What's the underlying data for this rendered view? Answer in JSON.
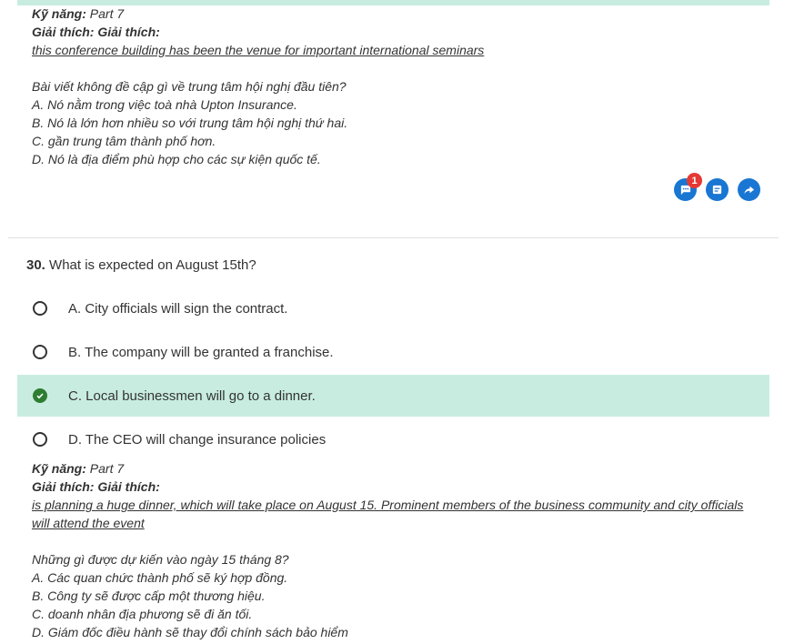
{
  "prev": {
    "skill_label": "Kỹ năng:",
    "skill_value": "Part 7",
    "explain_label": "Giải thích: Giải thích:",
    "quote": "this conference building has been the venue for important international seminars",
    "vi_question": "Bài viết không đề cập gì về trung tâm hội nghị đầu tiên?",
    "vi_options": [
      "A. Nó nằm trong việc toà nhà Upton Insurance.",
      "B. Nó là lớn hơn nhiều so với trung tâm hội nghị thứ hai.",
      "C. gần trung tâm thành phố hơn.",
      "D. Nó là địa điểm phù hợp cho các sự kiện quốc tế."
    ]
  },
  "actions": {
    "comment_icon": "comment-icon",
    "comment_badge": "1",
    "note_icon": "note-icon",
    "share_icon": "share-icon"
  },
  "question": {
    "number": "30.",
    "text": "What is expected on August 15th?",
    "options": [
      {
        "label": "A. City officials will sign the contract.",
        "state": "unselected"
      },
      {
        "label": "B. The company will be granted a franchise.",
        "state": "unselected"
      },
      {
        "label": "C. Local businessmen will go to a dinner.",
        "state": "correct"
      },
      {
        "label": "D. The CEO will change insurance policies",
        "state": "unselected"
      }
    ]
  },
  "explanation": {
    "skill_label": "Kỹ năng:",
    "skill_value": "Part 7",
    "explain_label": "Giải thích: Giải thích:",
    "quote": "is planning a huge dinner, which will take place on August 15. Prominent members of the business community and city officials will attend the event",
    "vi_question": "Những gì được dự kiến vào ngày 15 tháng 8?",
    "vi_options": [
      "A. Các quan chức thành phố sẽ ký hợp đồng.",
      "B. Công ty sẽ được cấp một thương hiệu.",
      "C. doanh nhân địa phương sẽ đi ăn tối.",
      "D. Giám đốc điều hành sẽ thay đổi chính sách bảo hiểm"
    ]
  },
  "colors": {
    "correct_bg": "#c8ede0",
    "accent": "#1976d2",
    "correct_check": "#2e7d32",
    "badge": "#e53935"
  }
}
